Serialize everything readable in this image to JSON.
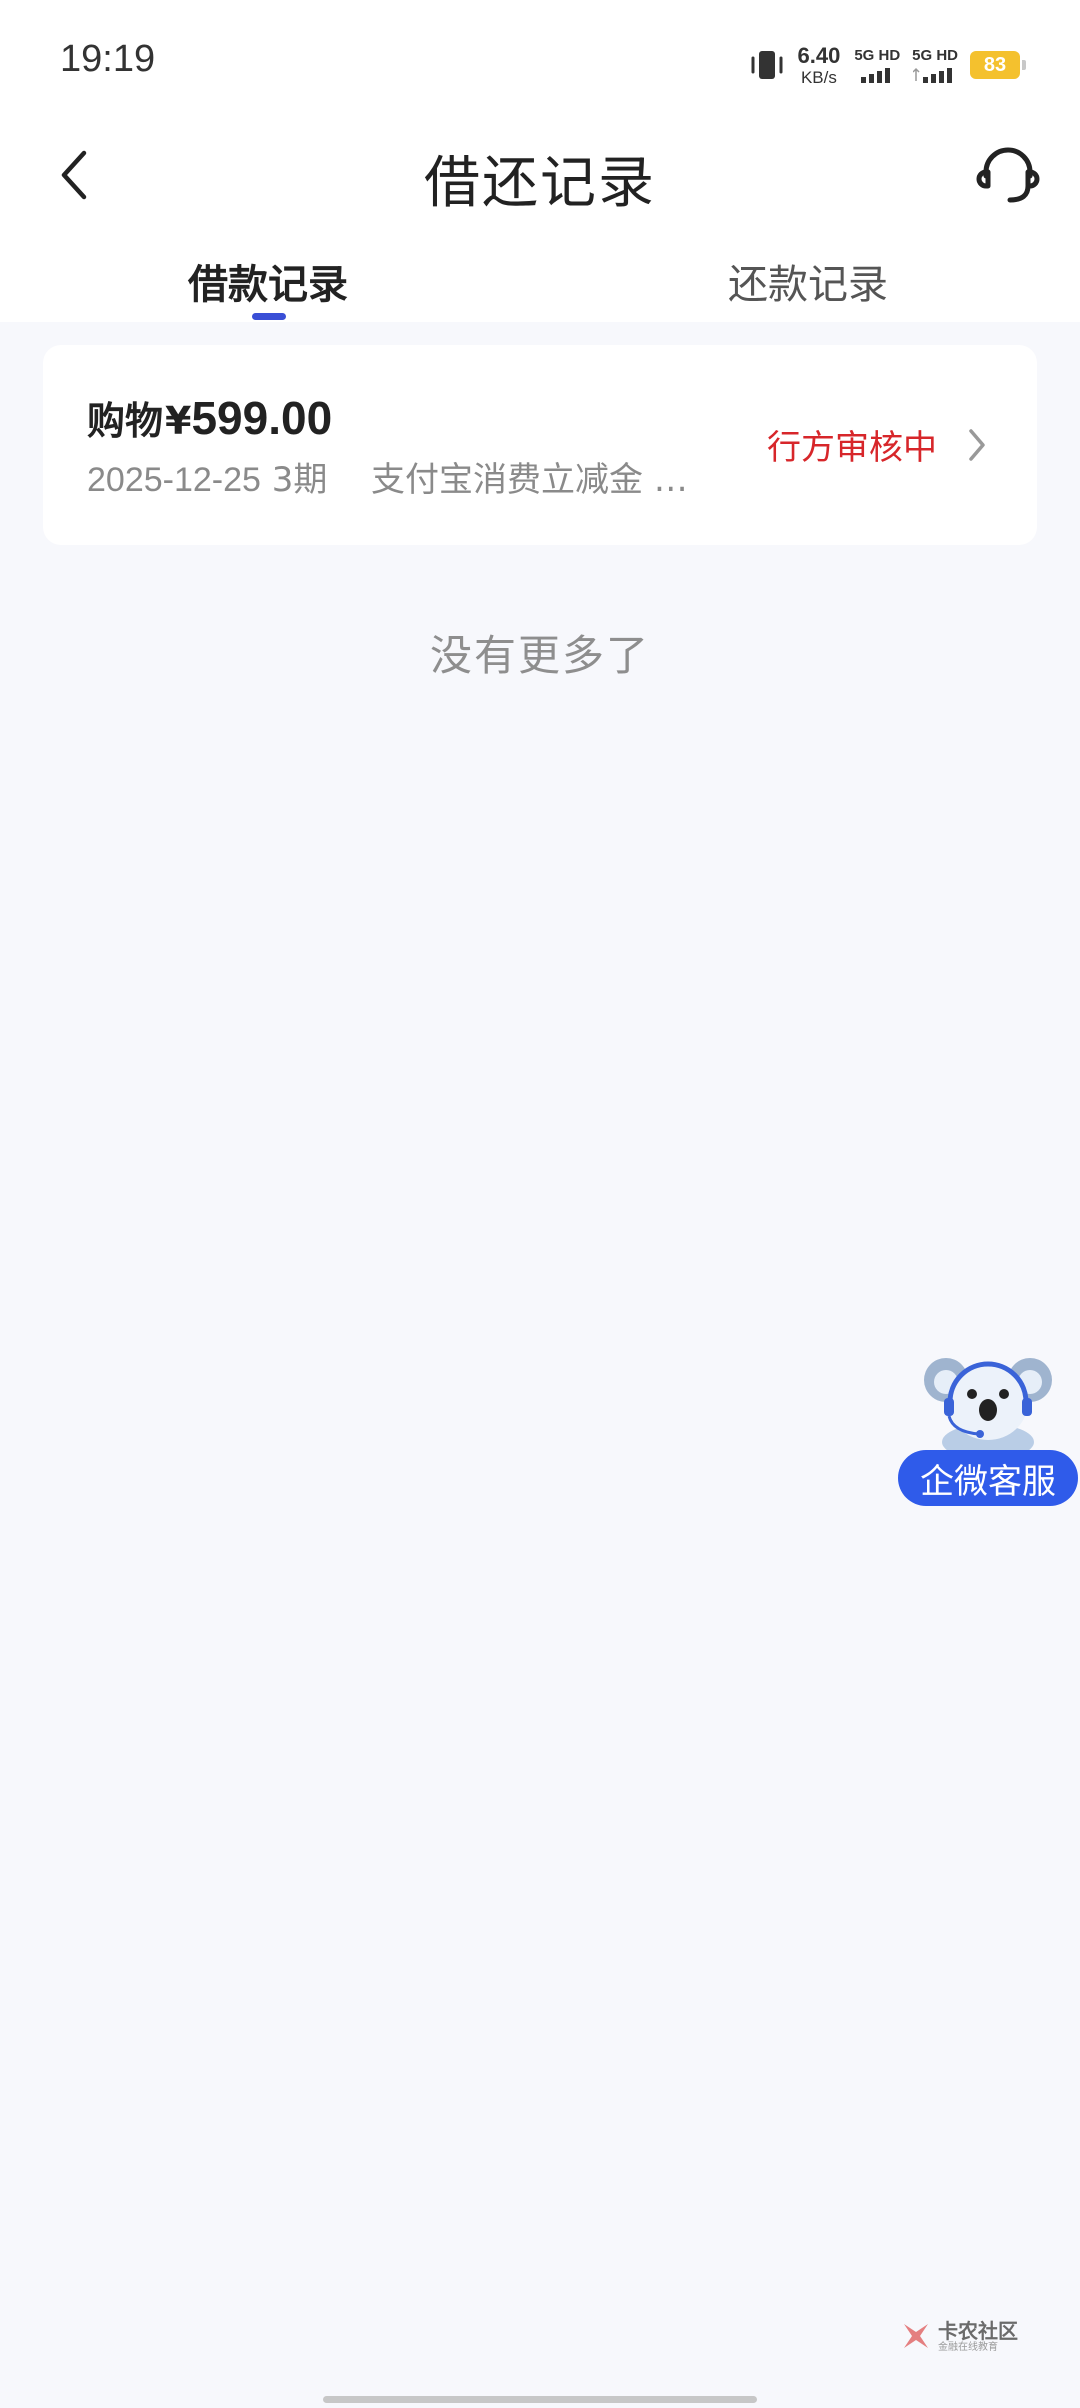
{
  "status_bar": {
    "time": "19:19",
    "net_speed_value": "6.40",
    "net_speed_unit": "KB/s",
    "sim1_label": "5G HD",
    "sim2_label": "5G HD",
    "battery": "83",
    "battery_color": "#f4c12e"
  },
  "nav": {
    "title": "借还记录",
    "back_icon": "chevron-left-icon",
    "service_icon": "headset-icon"
  },
  "tabs": [
    {
      "label": "借款记录",
      "active": true
    },
    {
      "label": "还款记录",
      "active": false
    }
  ],
  "records": [
    {
      "category": "购物",
      "currency": "¥",
      "amount": "599.00",
      "date": "2025-12-25",
      "term": "3期",
      "description": "支付宝消费立减金 …",
      "status": "行方审核中",
      "status_color": "#d7262a"
    }
  ],
  "list_end_text": "没有更多了",
  "float_service": {
    "label": "企微客服",
    "icon": "koala-mascot-icon"
  },
  "watermark": {
    "main": "卡农社区",
    "sub": "金融在线教育"
  },
  "accent_color": "#3a4fd6"
}
